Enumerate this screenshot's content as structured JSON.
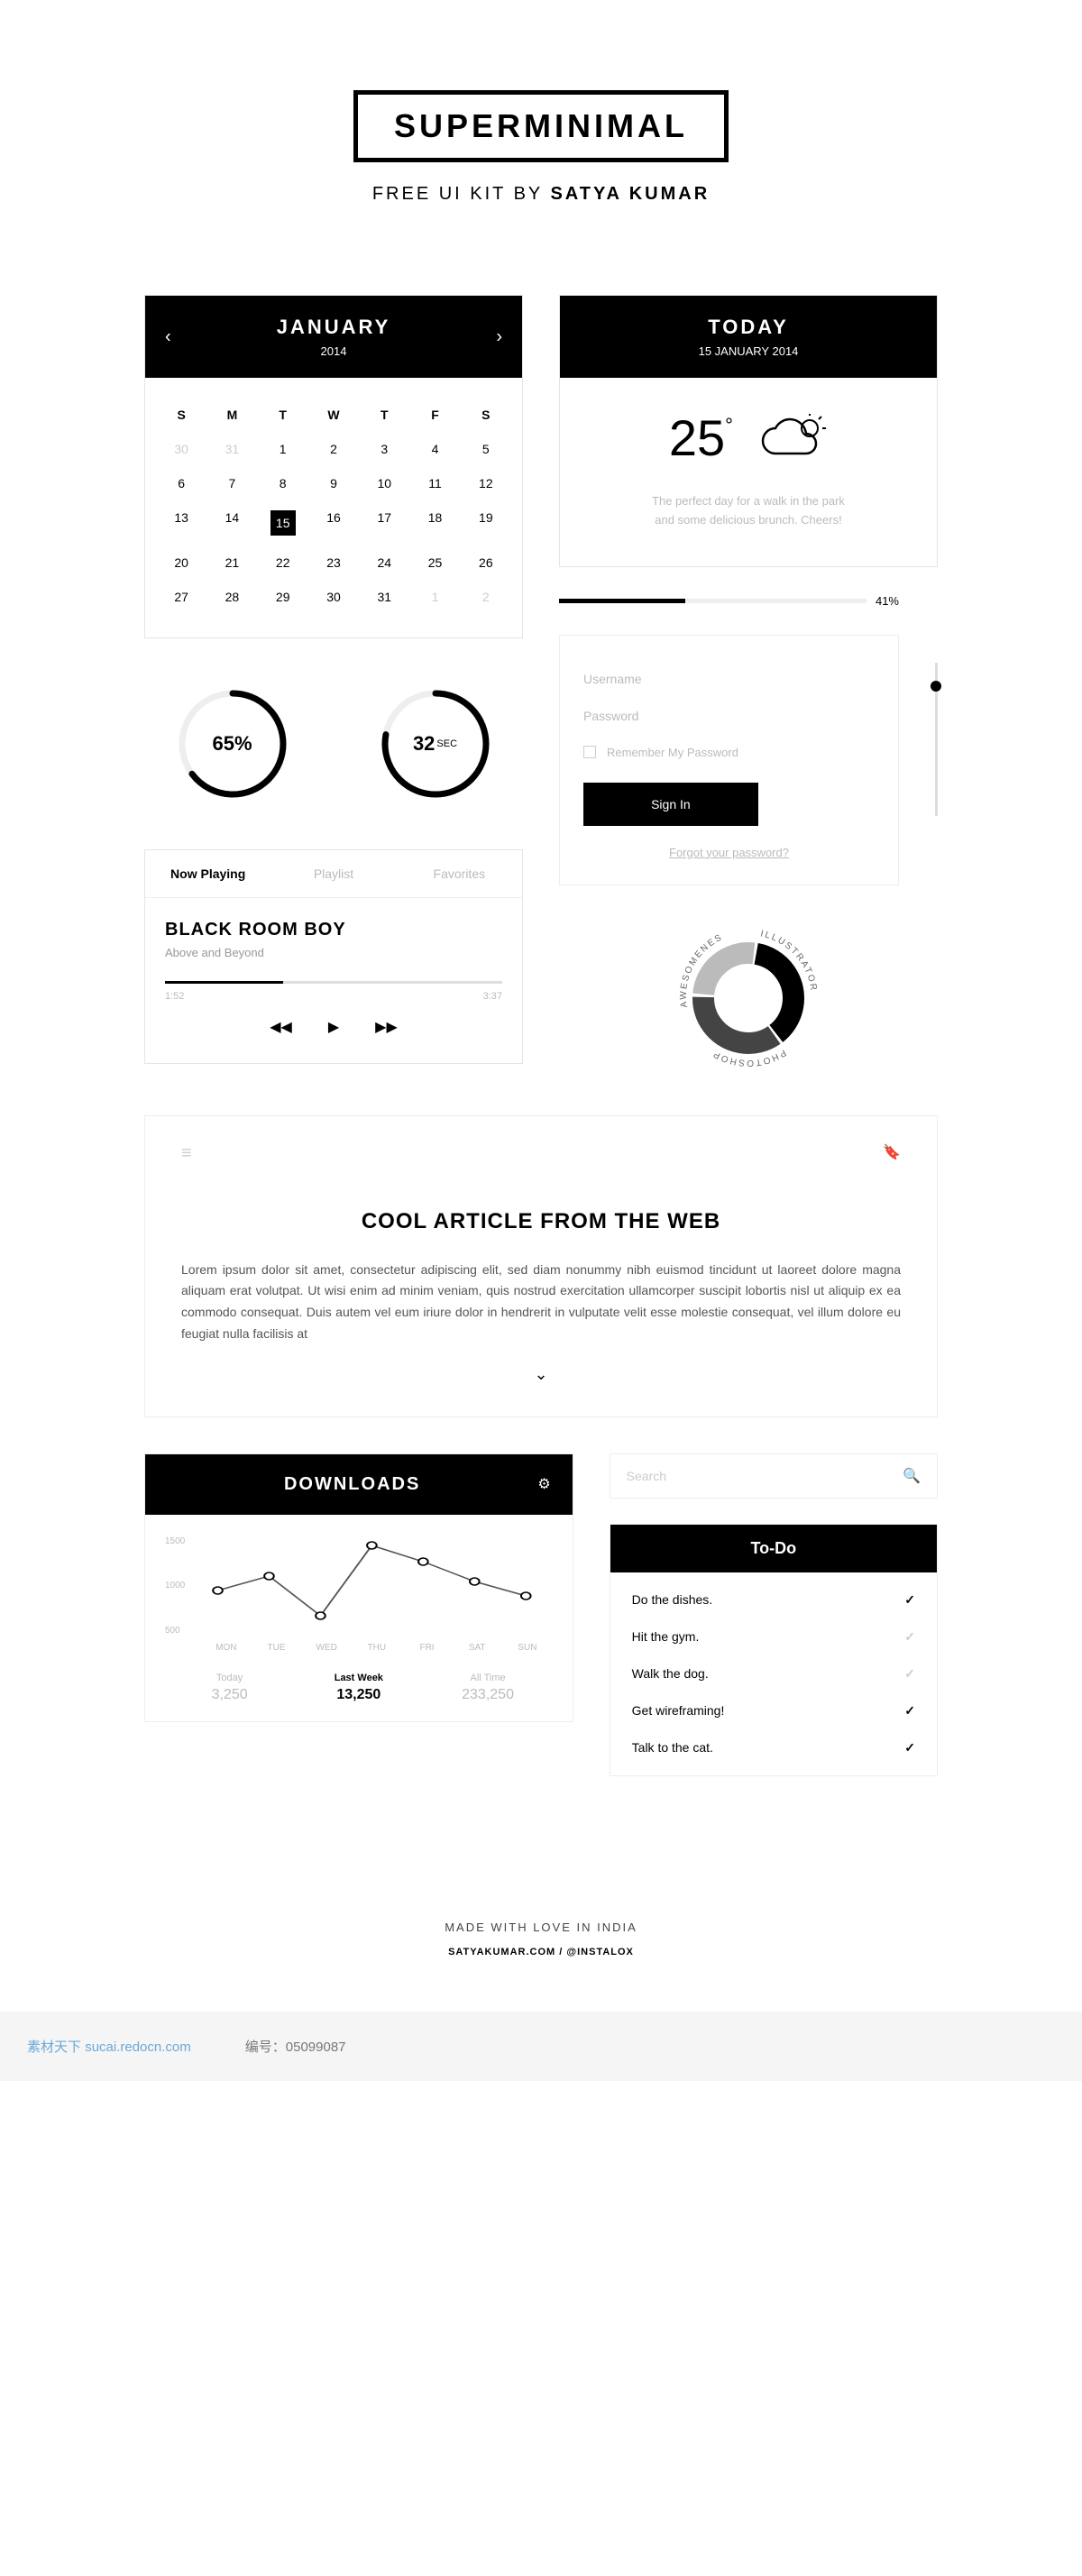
{
  "header": {
    "title": "SUPERMINIMAL",
    "subtitle_pre": "FREE UI KIT BY ",
    "subtitle_bold": "SATYA KUMAR"
  },
  "calendar": {
    "month": "JANUARY",
    "year": "2014",
    "dow": [
      "S",
      "M",
      "T",
      "W",
      "T",
      "F",
      "S"
    ],
    "weeks": [
      [
        {
          "d": "30",
          "dim": true
        },
        {
          "d": "31",
          "dim": true
        },
        {
          "d": "1"
        },
        {
          "d": "2"
        },
        {
          "d": "3"
        },
        {
          "d": "4"
        },
        {
          "d": "5"
        }
      ],
      [
        {
          "d": "6"
        },
        {
          "d": "7"
        },
        {
          "d": "8"
        },
        {
          "d": "9"
        },
        {
          "d": "10"
        },
        {
          "d": "11"
        },
        {
          "d": "12"
        }
      ],
      [
        {
          "d": "13"
        },
        {
          "d": "14"
        },
        {
          "d": "15",
          "sel": true
        },
        {
          "d": "16"
        },
        {
          "d": "17"
        },
        {
          "d": "18"
        },
        {
          "d": "19"
        }
      ],
      [
        {
          "d": "20"
        },
        {
          "d": "21"
        },
        {
          "d": "22"
        },
        {
          "d": "23"
        },
        {
          "d": "24"
        },
        {
          "d": "25"
        },
        {
          "d": "26"
        }
      ],
      [
        {
          "d": "27"
        },
        {
          "d": "28"
        },
        {
          "d": "29"
        },
        {
          "d": "30"
        },
        {
          "d": "31"
        },
        {
          "d": "1",
          "dim": true
        },
        {
          "d": "2",
          "dim": true
        }
      ]
    ]
  },
  "stats": {
    "percent": {
      "value": "65%",
      "progress": 65
    },
    "timer": {
      "value": "32",
      "unit": "SEC",
      "progress": 78
    }
  },
  "player": {
    "tabs": [
      "Now Playing",
      "Playlist",
      "Favorites"
    ],
    "track_title": "BLACK ROOM BOY",
    "track_artist": "Above and Beyond",
    "elapsed": "1:52",
    "duration": "3:37",
    "progress": 35
  },
  "weather": {
    "title": "TODAY",
    "date": "15 JANUARY 2014",
    "temp": "25",
    "desc1": "The perfect day for a walk in the park",
    "desc2": "and some delicious brunch. Cheers!"
  },
  "progress": {
    "value": 41,
    "label": "41%"
  },
  "login": {
    "user_ph": "Username",
    "pass_ph": "Password",
    "remember": "Remember My Password",
    "button": "Sign In",
    "forgot": "Forgot your password?"
  },
  "donut": {
    "labels": [
      "ILLUSTRATOR",
      "PHOTOSHOP",
      "AWESOMENESS"
    ]
  },
  "article": {
    "title": "COOL ARTICLE FROM THE WEB",
    "body": "Lorem ipsum dolor sit amet, consectetur adipiscing elit, sed diam nonummy nibh euismod tincidunt ut laoreet dolore magna aliquam erat volutpat. Ut wisi enim ad minim veniam, quis nostrud exercitation ullamcorper suscipit lobortis nisl ut aliquip ex ea commodo consequat. Duis autem vel eum iriure dolor in hendrerit in vulputate velit esse molestie consequat, vel illum dolore eu feugiat nulla facilisis at"
  },
  "downloads": {
    "title": "DOWNLOADS",
    "y_ticks": [
      "1500",
      "1000",
      "500"
    ],
    "x_ticks": [
      "MON",
      "TUE",
      "WED",
      "THU",
      "FRI",
      "SAT",
      "SUN"
    ],
    "stats": [
      {
        "label": "Today",
        "value": "3,250"
      },
      {
        "label": "Last Week",
        "value": "13,250",
        "active": true
      },
      {
        "label": "All Time",
        "value": "233,250"
      }
    ]
  },
  "chart_data": {
    "type": "line",
    "categories": [
      "MON",
      "TUE",
      "WED",
      "THU",
      "FRI",
      "SAT",
      "SUN"
    ],
    "values": [
      950,
      1100,
      700,
      1400,
      1250,
      1050,
      900
    ],
    "ylim": [
      500,
      1500
    ],
    "title": "DOWNLOADS",
    "xlabel": "",
    "ylabel": ""
  },
  "search": {
    "placeholder": "Search"
  },
  "todo": {
    "title": "To-Do",
    "items": [
      {
        "text": "Do the dishes.",
        "done": true
      },
      {
        "text": "Hit the gym.",
        "done": false
      },
      {
        "text": "Walk the dog.",
        "done": false
      },
      {
        "text": "Get wireframing!",
        "done": true
      },
      {
        "text": "Talk to the cat.",
        "done": true
      }
    ]
  },
  "footer": {
    "line1": "MADE WITH LOVE IN INDIA",
    "line2": "SATYAKUMAR.COM / @INSTALOX"
  },
  "meta": {
    "source_label": "素材天下",
    "source_url": "sucai.redocn.com",
    "id_label": "编号：",
    "id_value": "05099087"
  }
}
